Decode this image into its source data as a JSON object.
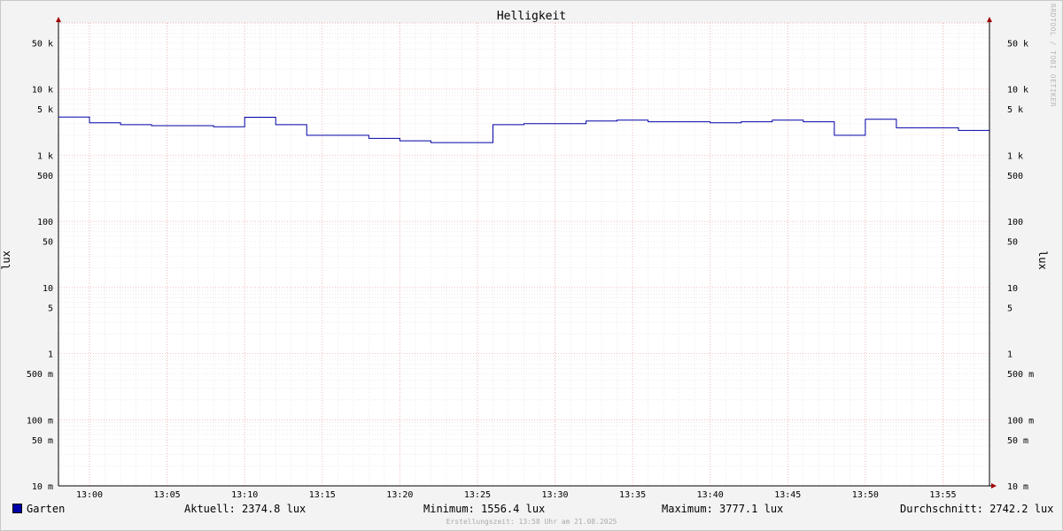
{
  "chart_data": {
    "type": "line",
    "title": "Helligkeit",
    "ylabel": "lux",
    "yscale": "log",
    "ylim": [
      0.01,
      100000
    ],
    "xlim": [
      "12:58",
      "13:58"
    ],
    "grid": true,
    "x_ticks": [
      "13:00",
      "13:05",
      "13:10",
      "13:15",
      "13:20",
      "13:25",
      "13:30",
      "13:35",
      "13:40",
      "13:45",
      "13:50",
      "13:55"
    ],
    "y_ticks": [
      {
        "value": 50000,
        "label": "50 k"
      },
      {
        "value": 10000,
        "label": "10 k"
      },
      {
        "value": 5000,
        "label": "5 k"
      },
      {
        "value": 1000,
        "label": "1 k"
      },
      {
        "value": 500,
        "label": "500"
      },
      {
        "value": 100,
        "label": "100"
      },
      {
        "value": 50,
        "label": "50"
      },
      {
        "value": 10,
        "label": "10"
      },
      {
        "value": 5,
        "label": "5"
      },
      {
        "value": 1,
        "label": "1"
      },
      {
        "value": 0.5,
        "label": "500 m"
      },
      {
        "value": 0.1,
        "label": "100 m"
      },
      {
        "value": 0.05,
        "label": "50 m"
      },
      {
        "value": 0.01,
        "label": "10 m"
      }
    ],
    "series": [
      {
        "name": "Garten",
        "color": "#0000a8",
        "x": [
          "12:58",
          "13:00",
          "13:02",
          "13:04",
          "13:06",
          "13:08",
          "13:10",
          "13:12",
          "13:14",
          "13:16",
          "13:18",
          "13:20",
          "13:22",
          "13:24",
          "13:26",
          "13:28",
          "13:30",
          "13:32",
          "13:34",
          "13:36",
          "13:38",
          "13:40",
          "13:42",
          "13:44",
          "13:46",
          "13:48",
          "13:50",
          "13:52",
          "13:54",
          "13:56",
          "13:58"
        ],
        "values": [
          3777.1,
          3100,
          2900,
          2800,
          2800,
          2700,
          3750,
          2900,
          2000,
          2000,
          1800,
          1650,
          1556.4,
          1556.4,
          2900,
          3000,
          3000,
          3300,
          3400,
          3200,
          3200,
          3100,
          3200,
          3400,
          3200,
          2000,
          3500,
          2600,
          2600,
          2374.8,
          2374.8
        ]
      }
    ]
  },
  "legend": {
    "series_name": "Garten",
    "current": "Aktuell: 2374.8 lux",
    "minimum": "Minimum: 1556.4 lux",
    "maximum": "Maximum: 3777.1 lux",
    "average": "Durchschnitt: 2742.2 lux"
  },
  "watermark": "RRDTOOL / TOBI OETIKER",
  "footer": "Erstellungszeit: 13:58 Uhr am 21.08.2025"
}
